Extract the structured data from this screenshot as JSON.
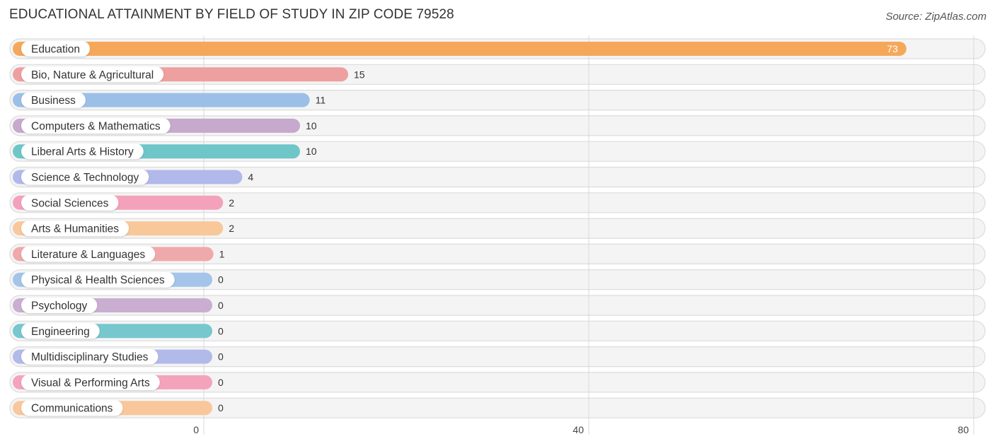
{
  "title": "EDUCATIONAL ATTAINMENT BY FIELD OF STUDY IN ZIP CODE 79528",
  "source": "Source: ZipAtlas.com",
  "chart_data": {
    "type": "bar",
    "orientation": "horizontal",
    "title": "EDUCATIONAL ATTAINMENT BY FIELD OF STUDY IN ZIP CODE 79528",
    "xlabel": "",
    "ylabel": "",
    "xlim": [
      0,
      80
    ],
    "xticks": [
      0,
      40,
      80
    ],
    "grid": true,
    "categories": [
      "Education",
      "Bio, Nature & Agricultural",
      "Business",
      "Computers & Mathematics",
      "Liberal Arts & History",
      "Science & Technology",
      "Social Sciences",
      "Arts & Humanities",
      "Literature & Languages",
      "Physical & Health Sciences",
      "Psychology",
      "Engineering",
      "Multidisciplinary Studies",
      "Visual & Performing Arts",
      "Communications"
    ],
    "values": [
      73,
      15,
      11,
      10,
      10,
      4,
      2,
      2,
      1,
      0,
      0,
      0,
      0,
      0,
      0
    ],
    "colors": [
      "#f5a85a",
      "#ee9fa0",
      "#9cbfe8",
      "#c6a9cd",
      "#6ec6c8",
      "#b1b9ea",
      "#f4a1bb",
      "#f9c89a",
      "#f0a9aa",
      "#a4c4ea",
      "#c9aed1",
      "#77c7cf",
      "#b2baea",
      "#f5a3bd",
      "#f9c79b"
    ]
  }
}
